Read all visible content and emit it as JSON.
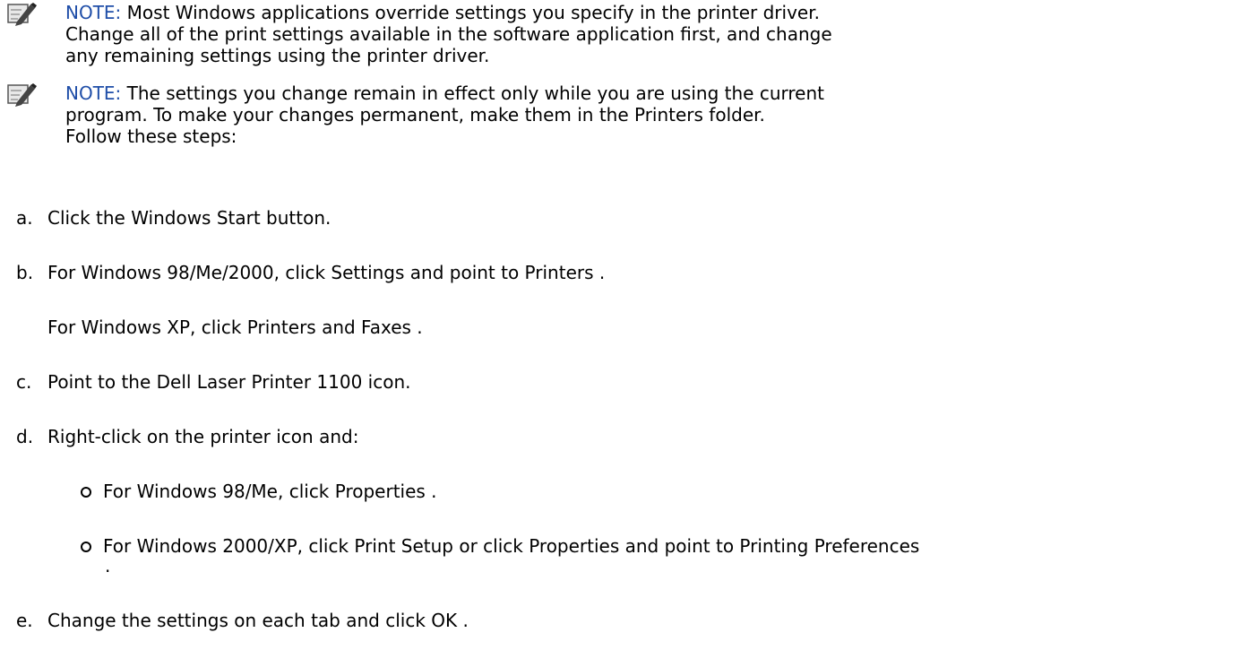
{
  "notes": [
    {
      "label": "NOTE:",
      "lines": [
        " Most Windows applications override settings you specify in the printer driver.",
        "Change all of the print settings available in the software application first, and change",
        "any remaining settings using the printer driver."
      ]
    },
    {
      "label": "NOTE:",
      "lines": [
        " The settings you change remain in effect only while you are using the current",
        "program. To make your changes permanent, make them in the Printers folder.",
        "Follow these steps:"
      ]
    }
  ],
  "steps": {
    "a": {
      "letter": "a.",
      "text": "Click the Windows Start button."
    },
    "b": {
      "letter": "b.",
      "text": "For Windows 98/Me/2000, click Settings and point to Printers ."
    },
    "b_extra": "For Windows XP, click Printers and Faxes .",
    "c": {
      "letter": "c.",
      "text": "Point to the Dell Laser Printer 1100 icon."
    },
    "d": {
      "letter": "d.",
      "text": "Right-click on the printer icon and:"
    },
    "d_bullets": [
      "For Windows 98/Me, click Properties .",
      "For Windows 2000/XP, click Print Setup or click Properties and point to Printing Preferences"
    ],
    "d_bullet_tail": ".",
    "e": {
      "letter": "e.",
      "text": "Change the settings on each tab and click OK ."
    }
  },
  "colors": {
    "note_label": "#1f4ea8",
    "text": "#000000"
  },
  "icons": {
    "note": "note-pencil-icon",
    "bullet": "hollow-circle-bullet-icon"
  }
}
